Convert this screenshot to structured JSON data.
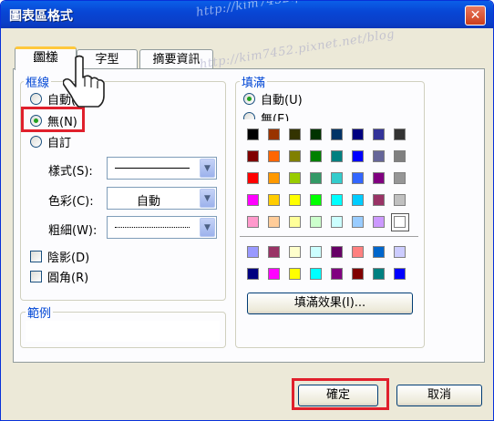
{
  "window": {
    "title": "圖表區格式",
    "close_glyph": "✕"
  },
  "watermark": "http://kim7452.pixnet.net/blog",
  "tabs": [
    {
      "label": "圖樣"
    },
    {
      "label": "字型"
    },
    {
      "label": "摘要資訊"
    }
  ],
  "border_group": {
    "title": "框線",
    "options": [
      {
        "label": "自動(A)",
        "checked": false
      },
      {
        "label": "無(N)",
        "checked": true
      },
      {
        "label": "自訂",
        "checked": false
      }
    ],
    "style_label": "樣式(S):",
    "color_label": "色彩(C):",
    "color_value": "自動",
    "weight_label": "粗細(W):",
    "shadow_label": "陰影(D)",
    "round_label": "圓角(R)"
  },
  "preview_group": {
    "title": "範例"
  },
  "fill_group": {
    "title": "填滿",
    "options": [
      {
        "label": "自動(U)",
        "checked": true
      },
      {
        "label": "無(E)",
        "checked": false
      }
    ],
    "palette_main": [
      [
        "#000000",
        "#993300",
        "#333300",
        "#003300",
        "#003366",
        "#000080",
        "#333399",
        "#333333"
      ],
      [
        "#800000",
        "#ff6600",
        "#808000",
        "#008000",
        "#008080",
        "#0000ff",
        "#666699",
        "#808080"
      ],
      [
        "#ff0000",
        "#ff9900",
        "#99cc00",
        "#339966",
        "#33cccc",
        "#3366ff",
        "#800080",
        "#969696"
      ],
      [
        "#ff00ff",
        "#ffcc00",
        "#ffff00",
        "#00ff00",
        "#00ffff",
        "#00ccff",
        "#993366",
        "#c0c0c0"
      ],
      [
        "#ff99cc",
        "#ffcc99",
        "#ffff99",
        "#ccffcc",
        "#ccffff",
        "#99ccff",
        "#cc99ff",
        "#ffffff"
      ]
    ],
    "palette_chart": [
      [
        "#9999ff",
        "#993366",
        "#ffffcc",
        "#ccffff",
        "#660066",
        "#ff8080",
        "#0066cc",
        "#ccccff"
      ],
      [
        "#000080",
        "#ff00ff",
        "#ffff00",
        "#00ffff",
        "#800080",
        "#800000",
        "#008080",
        "#0000ff"
      ]
    ],
    "effects_button": "填滿效果(I)..."
  },
  "footer": {
    "ok_label": "確定",
    "cancel_label": "取消"
  },
  "colors": {
    "accent": "#0046d5",
    "highlight": "#e0202c",
    "title_bar": "#0a46d5"
  }
}
